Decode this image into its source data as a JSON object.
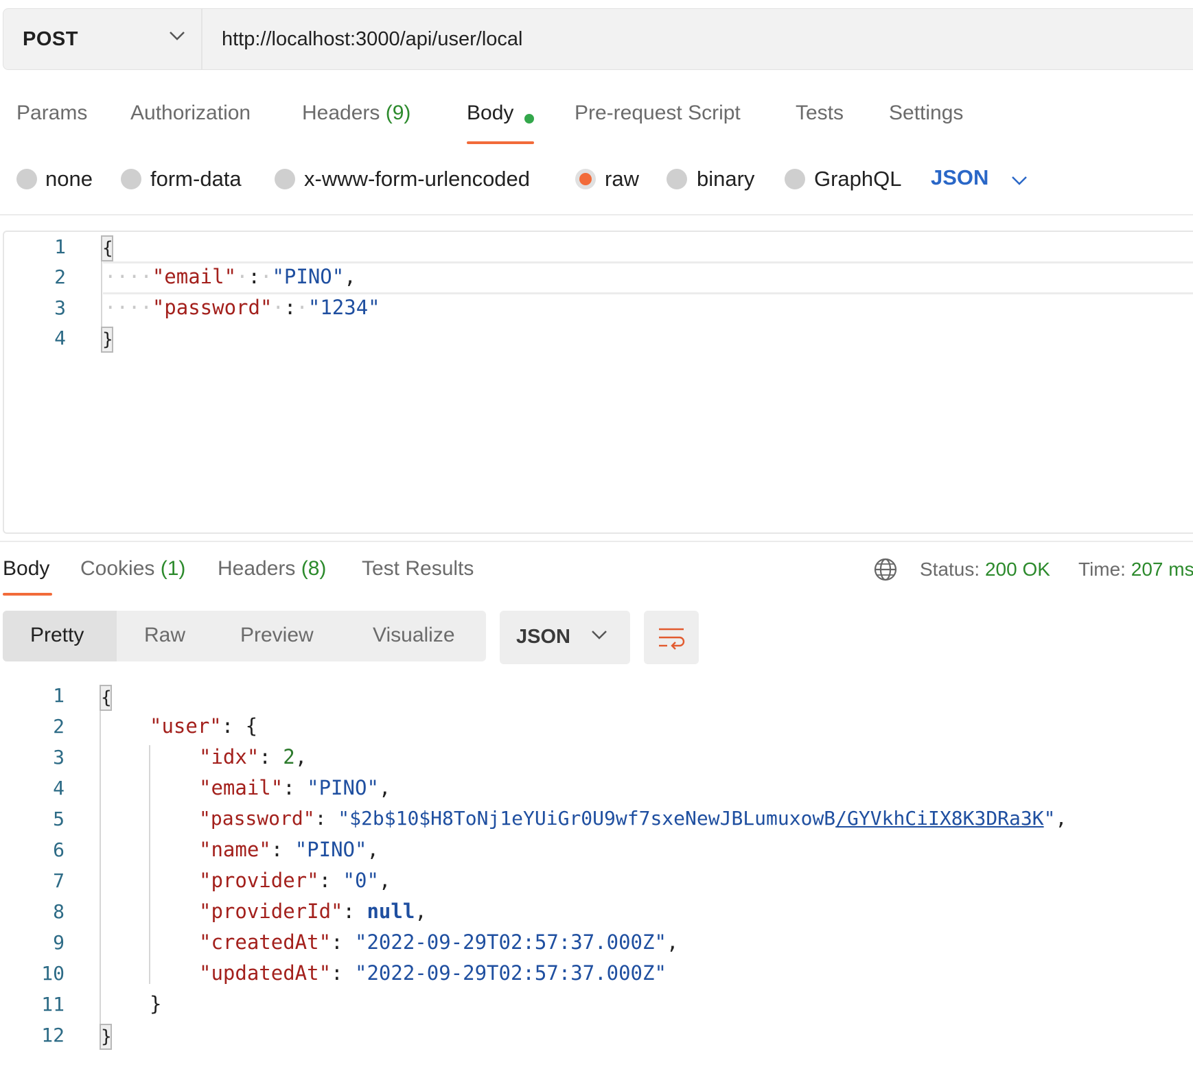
{
  "request": {
    "method": "POST",
    "url": "http://localhost:3000/api/user/local",
    "tabs": [
      {
        "label": "Params",
        "count": ""
      },
      {
        "label": "Authorization",
        "count": ""
      },
      {
        "label": "Headers",
        "count": "(9)"
      },
      {
        "label": "Body",
        "count": ""
      },
      {
        "label": "Pre-request Script",
        "count": ""
      },
      {
        "label": "Tests",
        "count": ""
      },
      {
        "label": "Settings",
        "count": ""
      }
    ],
    "active_tab": "Body",
    "body_types": [
      "none",
      "form-data",
      "x-www-form-urlencoded",
      "raw",
      "binary",
      "GraphQL"
    ],
    "selected_body_type": "raw",
    "raw_format": "JSON",
    "body_lines": [
      {
        "num": "1"
      },
      {
        "num": "2",
        "key": "\"email\"",
        "colon": ":",
        "value": "\"PINO\"",
        "tail": ","
      },
      {
        "num": "3",
        "key": "\"password\"",
        "colon": ":",
        "value": "\"1234\"",
        "tail": ""
      },
      {
        "num": "4"
      }
    ],
    "brace_open": "{",
    "brace_close": "}"
  },
  "response": {
    "tabs": [
      {
        "label": "Body",
        "count": ""
      },
      {
        "label": "Cookies",
        "count": "(1)"
      },
      {
        "label": "Headers",
        "count": "(8)"
      },
      {
        "label": "Test Results",
        "count": ""
      }
    ],
    "active_tab": "Body",
    "status_label": "Status:",
    "status_value": "200 OK",
    "time_label": "Time:",
    "time_value": "207 ms",
    "view_modes": [
      "Pretty",
      "Raw",
      "Preview",
      "Visualize"
    ],
    "active_view": "Pretty",
    "format": "JSON",
    "line_numbers": [
      "1",
      "2",
      "3",
      "4",
      "5",
      "6",
      "7",
      "8",
      "9",
      "10",
      "11",
      "12"
    ],
    "code": {
      "open": "{",
      "user_key": "\"user\"",
      "user_open": ": {",
      "fields": [
        {
          "key": "\"idx\"",
          "value": "2",
          "type": "number",
          "tail": ","
        },
        {
          "key": "\"email\"",
          "value": "\"PINO\"",
          "type": "string",
          "tail": ","
        },
        {
          "key": "\"password\"",
          "value_a": "\"$2b$10$H8ToNj1eYUiGr0U9wf7sxeNewJBLumuxowB",
          "value_b": "/GYVkhCiIX8K3DRa3K",
          "value_c": "\"",
          "type": "string",
          "tail": ","
        },
        {
          "key": "\"name\"",
          "value": "\"PINO\"",
          "type": "string",
          "tail": ","
        },
        {
          "key": "\"provider\"",
          "value": "\"0\"",
          "type": "string",
          "tail": ","
        },
        {
          "key": "\"providerId\"",
          "value": "null",
          "type": "keyword",
          "tail": ","
        },
        {
          "key": "\"createdAt\"",
          "value": "\"2022-09-29T02:57:37.000Z\"",
          "type": "string",
          "tail": ","
        },
        {
          "key": "\"updatedAt\"",
          "value": "\"2022-09-29T02:57:37.000Z\"",
          "type": "string",
          "tail": ""
        }
      ],
      "user_close": "}",
      "close": "}"
    }
  },
  "icons": {
    "method_dropdown": "chevron-down-icon",
    "format_dropdown": "chevron-down-icon",
    "response_format_dropdown": "chevron-down-icon",
    "network": "globe-icon",
    "wrap": "wrap-lines-icon"
  },
  "colors": {
    "accent": "#f26b3a",
    "count_green": "#2c8a2c",
    "json_link_blue": "#2a67c7",
    "code_key": "#a3201c",
    "code_string": "#1f4fa0"
  }
}
